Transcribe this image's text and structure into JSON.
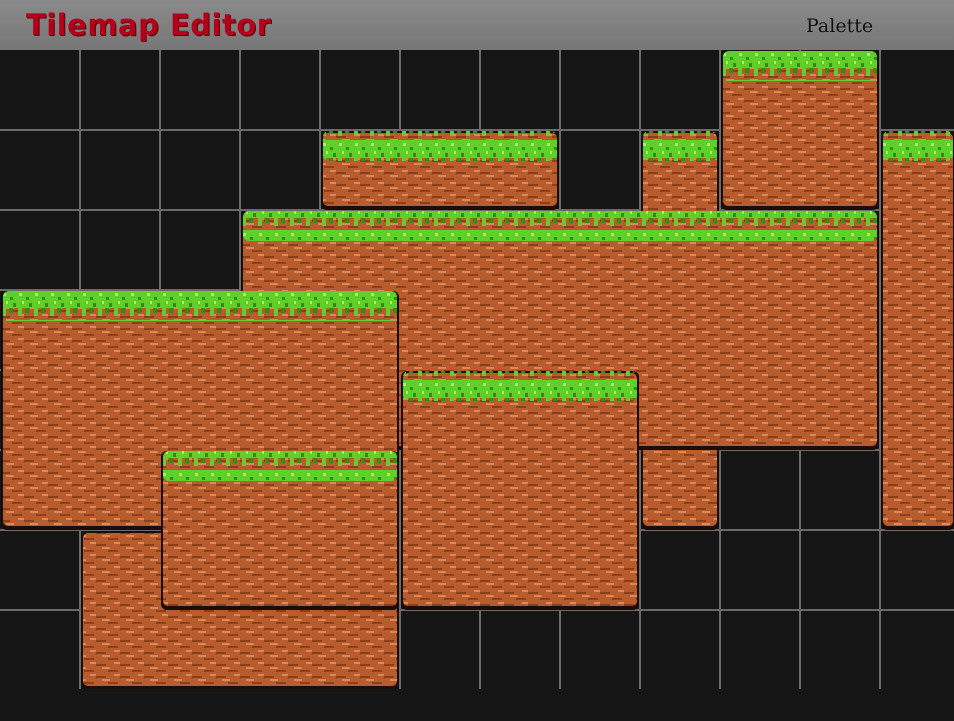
{
  "app": {
    "title": "Tilemap Editor"
  },
  "toolbar": {
    "palette_label": "Palette"
  },
  "map": {
    "tile_size": 80,
    "columns": 12,
    "rows": 8,
    "colors": {
      "background": "#151515",
      "grid": "#6a6a6a",
      "dirt": "#b85c2e",
      "dirt_dark": "#8a3f1a",
      "dirt_light": "#d98a5a",
      "outline": "#1a0c06",
      "grass": "#5fcf2a",
      "grass_dark": "#2f8f14",
      "grass_light": "#a8f060"
    },
    "platforms": [
      {
        "id": "tall-right",
        "col": 9,
        "row": 0,
        "w": 2,
        "h": 2,
        "grass": true
      },
      {
        "id": "far-right",
        "col": 11,
        "row": 1,
        "w": 1,
        "h": 5,
        "grass": true
      },
      {
        "id": "right-back",
        "col": 8,
        "row": 1,
        "w": 1,
        "h": 5,
        "grass": true
      },
      {
        "id": "upper-middle",
        "col": 4,
        "row": 1,
        "w": 3,
        "h": 1,
        "grass": true
      },
      {
        "id": "long-middle",
        "col": 3,
        "row": 2,
        "w": 8,
        "h": 3,
        "grass": true
      },
      {
        "id": "left-wide",
        "col": 0,
        "row": 3,
        "w": 5,
        "h": 3,
        "grass": true
      },
      {
        "id": "left-pillar",
        "col": 1,
        "row": 6,
        "w": 4,
        "h": 2,
        "grass": false
      },
      {
        "id": "center-block",
        "col": 5,
        "row": 4,
        "w": 3,
        "h": 3,
        "grass": true
      },
      {
        "id": "low-front",
        "col": 2,
        "row": 5,
        "w": 3,
        "h": 2,
        "grass": true
      }
    ]
  }
}
